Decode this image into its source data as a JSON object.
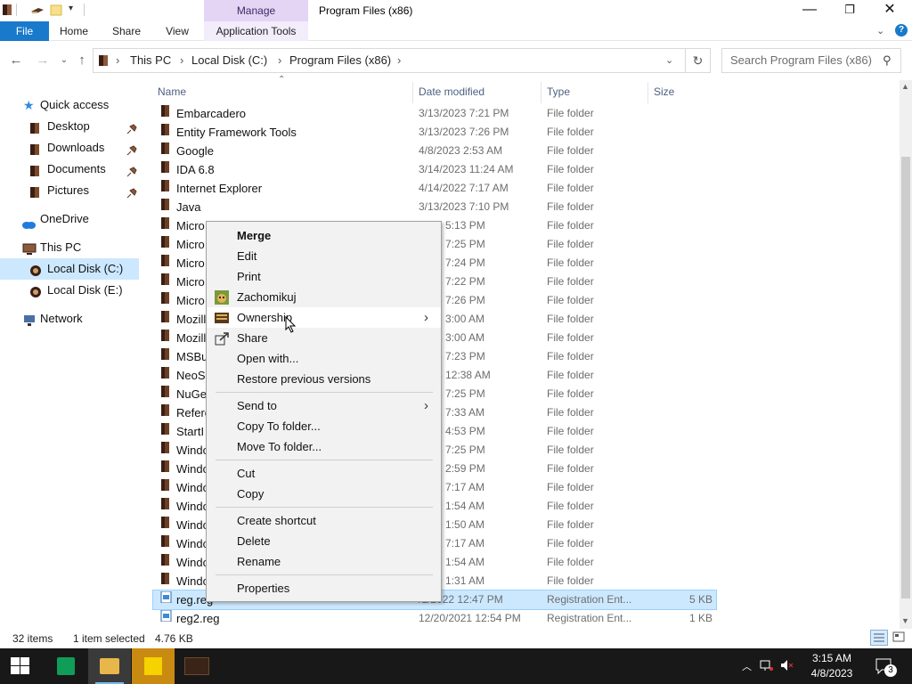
{
  "window": {
    "title": "Program Files (x86)",
    "manage_label": "Manage",
    "min": "—",
    "max": "❐",
    "close": "✕"
  },
  "ribbon": {
    "tabs": [
      "File",
      "Home",
      "Share",
      "View",
      "Application Tools"
    ]
  },
  "address": {
    "crumbs": [
      "This PC",
      "Local Disk (C:)",
      "Program Files (x86)"
    ],
    "search_placeholder": "Search Program Files (x86)"
  },
  "nav": {
    "items": [
      {
        "label": "Quick access",
        "icon": "star-icon"
      },
      {
        "label": "Desktop",
        "icon": "folder-icon",
        "pinned": true
      },
      {
        "label": "Downloads",
        "icon": "folder-icon",
        "pinned": true
      },
      {
        "label": "Documents",
        "icon": "folder-icon",
        "pinned": true
      },
      {
        "label": "Pictures",
        "icon": "folder-icon",
        "pinned": true
      },
      {
        "label": "OneDrive",
        "icon": "cloud-icon"
      },
      {
        "label": "This PC",
        "icon": "pc-icon"
      },
      {
        "label": "Local Disk (C:)",
        "icon": "disk-icon",
        "selected": true
      },
      {
        "label": "Local Disk (E:)",
        "icon": "disk-icon"
      },
      {
        "label": "Network",
        "icon": "network-icon"
      }
    ]
  },
  "columns": {
    "name": "Name",
    "date": "Date modified",
    "type": "Type",
    "size": "Size"
  },
  "files": [
    {
      "name": "Embarcadero",
      "date": "3/13/2023 7:21 PM",
      "type": "File folder",
      "size": ""
    },
    {
      "name": "Entity Framework Tools",
      "date": "3/13/2023 7:26 PM",
      "type": "File folder",
      "size": ""
    },
    {
      "name": "Google",
      "date": "4/8/2023 2:53 AM",
      "type": "File folder",
      "size": ""
    },
    {
      "name": "IDA 6.8",
      "date": "3/14/2023 11:24 AM",
      "type": "File folder",
      "size": ""
    },
    {
      "name": "Internet Explorer",
      "date": "4/14/2022 7:17 AM",
      "type": "File folder",
      "size": ""
    },
    {
      "name": "Java",
      "date": "3/13/2023 7:10 PM",
      "type": "File folder",
      "size": ""
    },
    {
      "name": "Micro",
      "date": "2023 5:13 PM",
      "type": "File folder",
      "size": ""
    },
    {
      "name": "Micro",
      "date": "2023 7:25 PM",
      "type": "File folder",
      "size": ""
    },
    {
      "name": "Micro",
      "date": "2023 7:24 PM",
      "type": "File folder",
      "size": ""
    },
    {
      "name": "Micro",
      "date": "2023 7:22 PM",
      "type": "File folder",
      "size": ""
    },
    {
      "name": "Micro",
      "date": "2023 7:26 PM",
      "type": "File folder",
      "size": ""
    },
    {
      "name": "Mozill",
      "date": "2023 3:00 AM",
      "type": "File folder",
      "size": ""
    },
    {
      "name": "Mozill",
      "date": "2023 3:00 AM",
      "type": "File folder",
      "size": ""
    },
    {
      "name": "MSBu",
      "date": "2023 7:23 PM",
      "type": "File folder",
      "size": ""
    },
    {
      "name": "NeoS",
      "date": "2023 12:38 AM",
      "type": "File folder",
      "size": ""
    },
    {
      "name": "NuGe",
      "date": "2023 7:25 PM",
      "type": "File folder",
      "size": ""
    },
    {
      "name": "Refere",
      "date": "2022 7:33 AM",
      "type": "File folder",
      "size": ""
    },
    {
      "name": "StartI",
      "date": "2023 4:53 PM",
      "type": "File folder",
      "size": ""
    },
    {
      "name": "Windo",
      "date": "2023 7:25 PM",
      "type": "File folder",
      "size": ""
    },
    {
      "name": "Windo",
      "date": "2022 2:59 PM",
      "type": "File folder",
      "size": ""
    },
    {
      "name": "Windo",
      "date": "2022 7:17 AM",
      "type": "File folder",
      "size": ""
    },
    {
      "name": "Windo",
      "date": "2019 1:54 AM",
      "type": "File folder",
      "size": ""
    },
    {
      "name": "Windo",
      "date": "2019 1:50 AM",
      "type": "File folder",
      "size": ""
    },
    {
      "name": "Windo",
      "date": "2022 7:17 AM",
      "type": "File folder",
      "size": ""
    },
    {
      "name": "Windo",
      "date": "2019 1:54 AM",
      "type": "File folder",
      "size": ""
    },
    {
      "name": "Windo",
      "date": "2019 1:31 AM",
      "type": "File folder",
      "size": ""
    },
    {
      "name": "reg.reg",
      "date": "/1/2022 12:47 PM",
      "type": "Registration Ent...",
      "size": "5 KB",
      "selected": true,
      "kind": "reg"
    },
    {
      "name": "reg2.reg",
      "date": "12/20/2021 12:54 PM",
      "type": "Registration Ent...",
      "size": "1 KB",
      "kind": "reg"
    }
  ],
  "status": {
    "items": "32 items",
    "selected": "1 item selected",
    "size": "4.76 KB"
  },
  "context_menu": {
    "items": [
      {
        "label": "Merge",
        "bold": true
      },
      {
        "label": "Edit"
      },
      {
        "label": "Print"
      },
      {
        "label": "Zachomikuj",
        "icon": "hamster-icon"
      },
      {
        "label": "Ownership",
        "icon": "ownership-icon",
        "submenu": true,
        "hover": true
      },
      {
        "label": "Share",
        "icon": "share-icon"
      },
      {
        "label": "Open with..."
      },
      {
        "label": "Restore previous versions"
      },
      {
        "sep": true
      },
      {
        "label": "Send to",
        "submenu": true
      },
      {
        "label": "Copy To folder..."
      },
      {
        "label": "Move To folder..."
      },
      {
        "sep": true
      },
      {
        "label": "Cut"
      },
      {
        "label": "Copy"
      },
      {
        "sep": true
      },
      {
        "label": "Create shortcut"
      },
      {
        "label": "Delete"
      },
      {
        "label": "Rename"
      },
      {
        "sep": true
      },
      {
        "label": "Properties"
      }
    ]
  },
  "taskbar": {
    "time": "3:15 AM",
    "date": "4/8/2023",
    "notifications": "3"
  },
  "colors": {
    "file_tab": "#1979ca",
    "manage_tab": "#e5d5f5",
    "selection": "#cce8ff",
    "folder": "#3a1e14"
  }
}
